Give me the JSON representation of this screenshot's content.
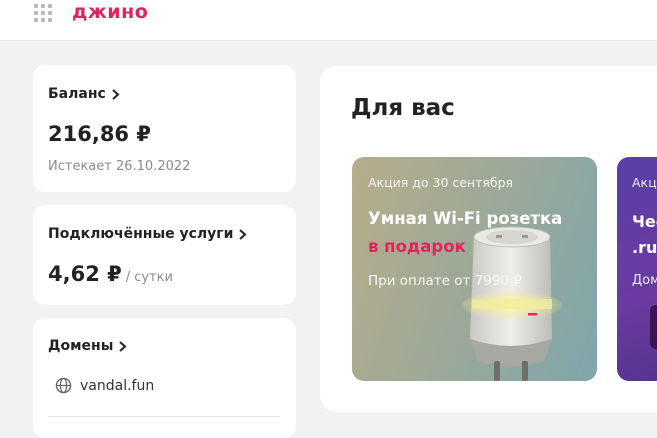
{
  "header": {
    "logo_text": "джино",
    "brand_color": "#e0245e"
  },
  "balance": {
    "title": "Баланс",
    "amount": "216,86 ₽",
    "expires": "Истекает 26.10.2022"
  },
  "services": {
    "title": "Подключённые услуги",
    "amount": "4,62 ₽",
    "period": "/ сутки"
  },
  "domains": {
    "title": "Домены",
    "items": [
      {
        "name": "vandal.fun",
        "icon": "globe-icon"
      }
    ]
  },
  "for_you": {
    "title": "Для вас",
    "promos": [
      {
        "eyebrow": "Акция до 30 сентября",
        "headline": "Умная Wi-Fi розетка",
        "headline_accent": "в подарок",
        "note": "При оплате от 7990 ₽",
        "image": "smart-socket"
      },
      {
        "eyebrow": "Акц",
        "headline_line1": "Чес",
        "headline_line2": ".ru",
        "note": "Дом"
      }
    ]
  }
}
